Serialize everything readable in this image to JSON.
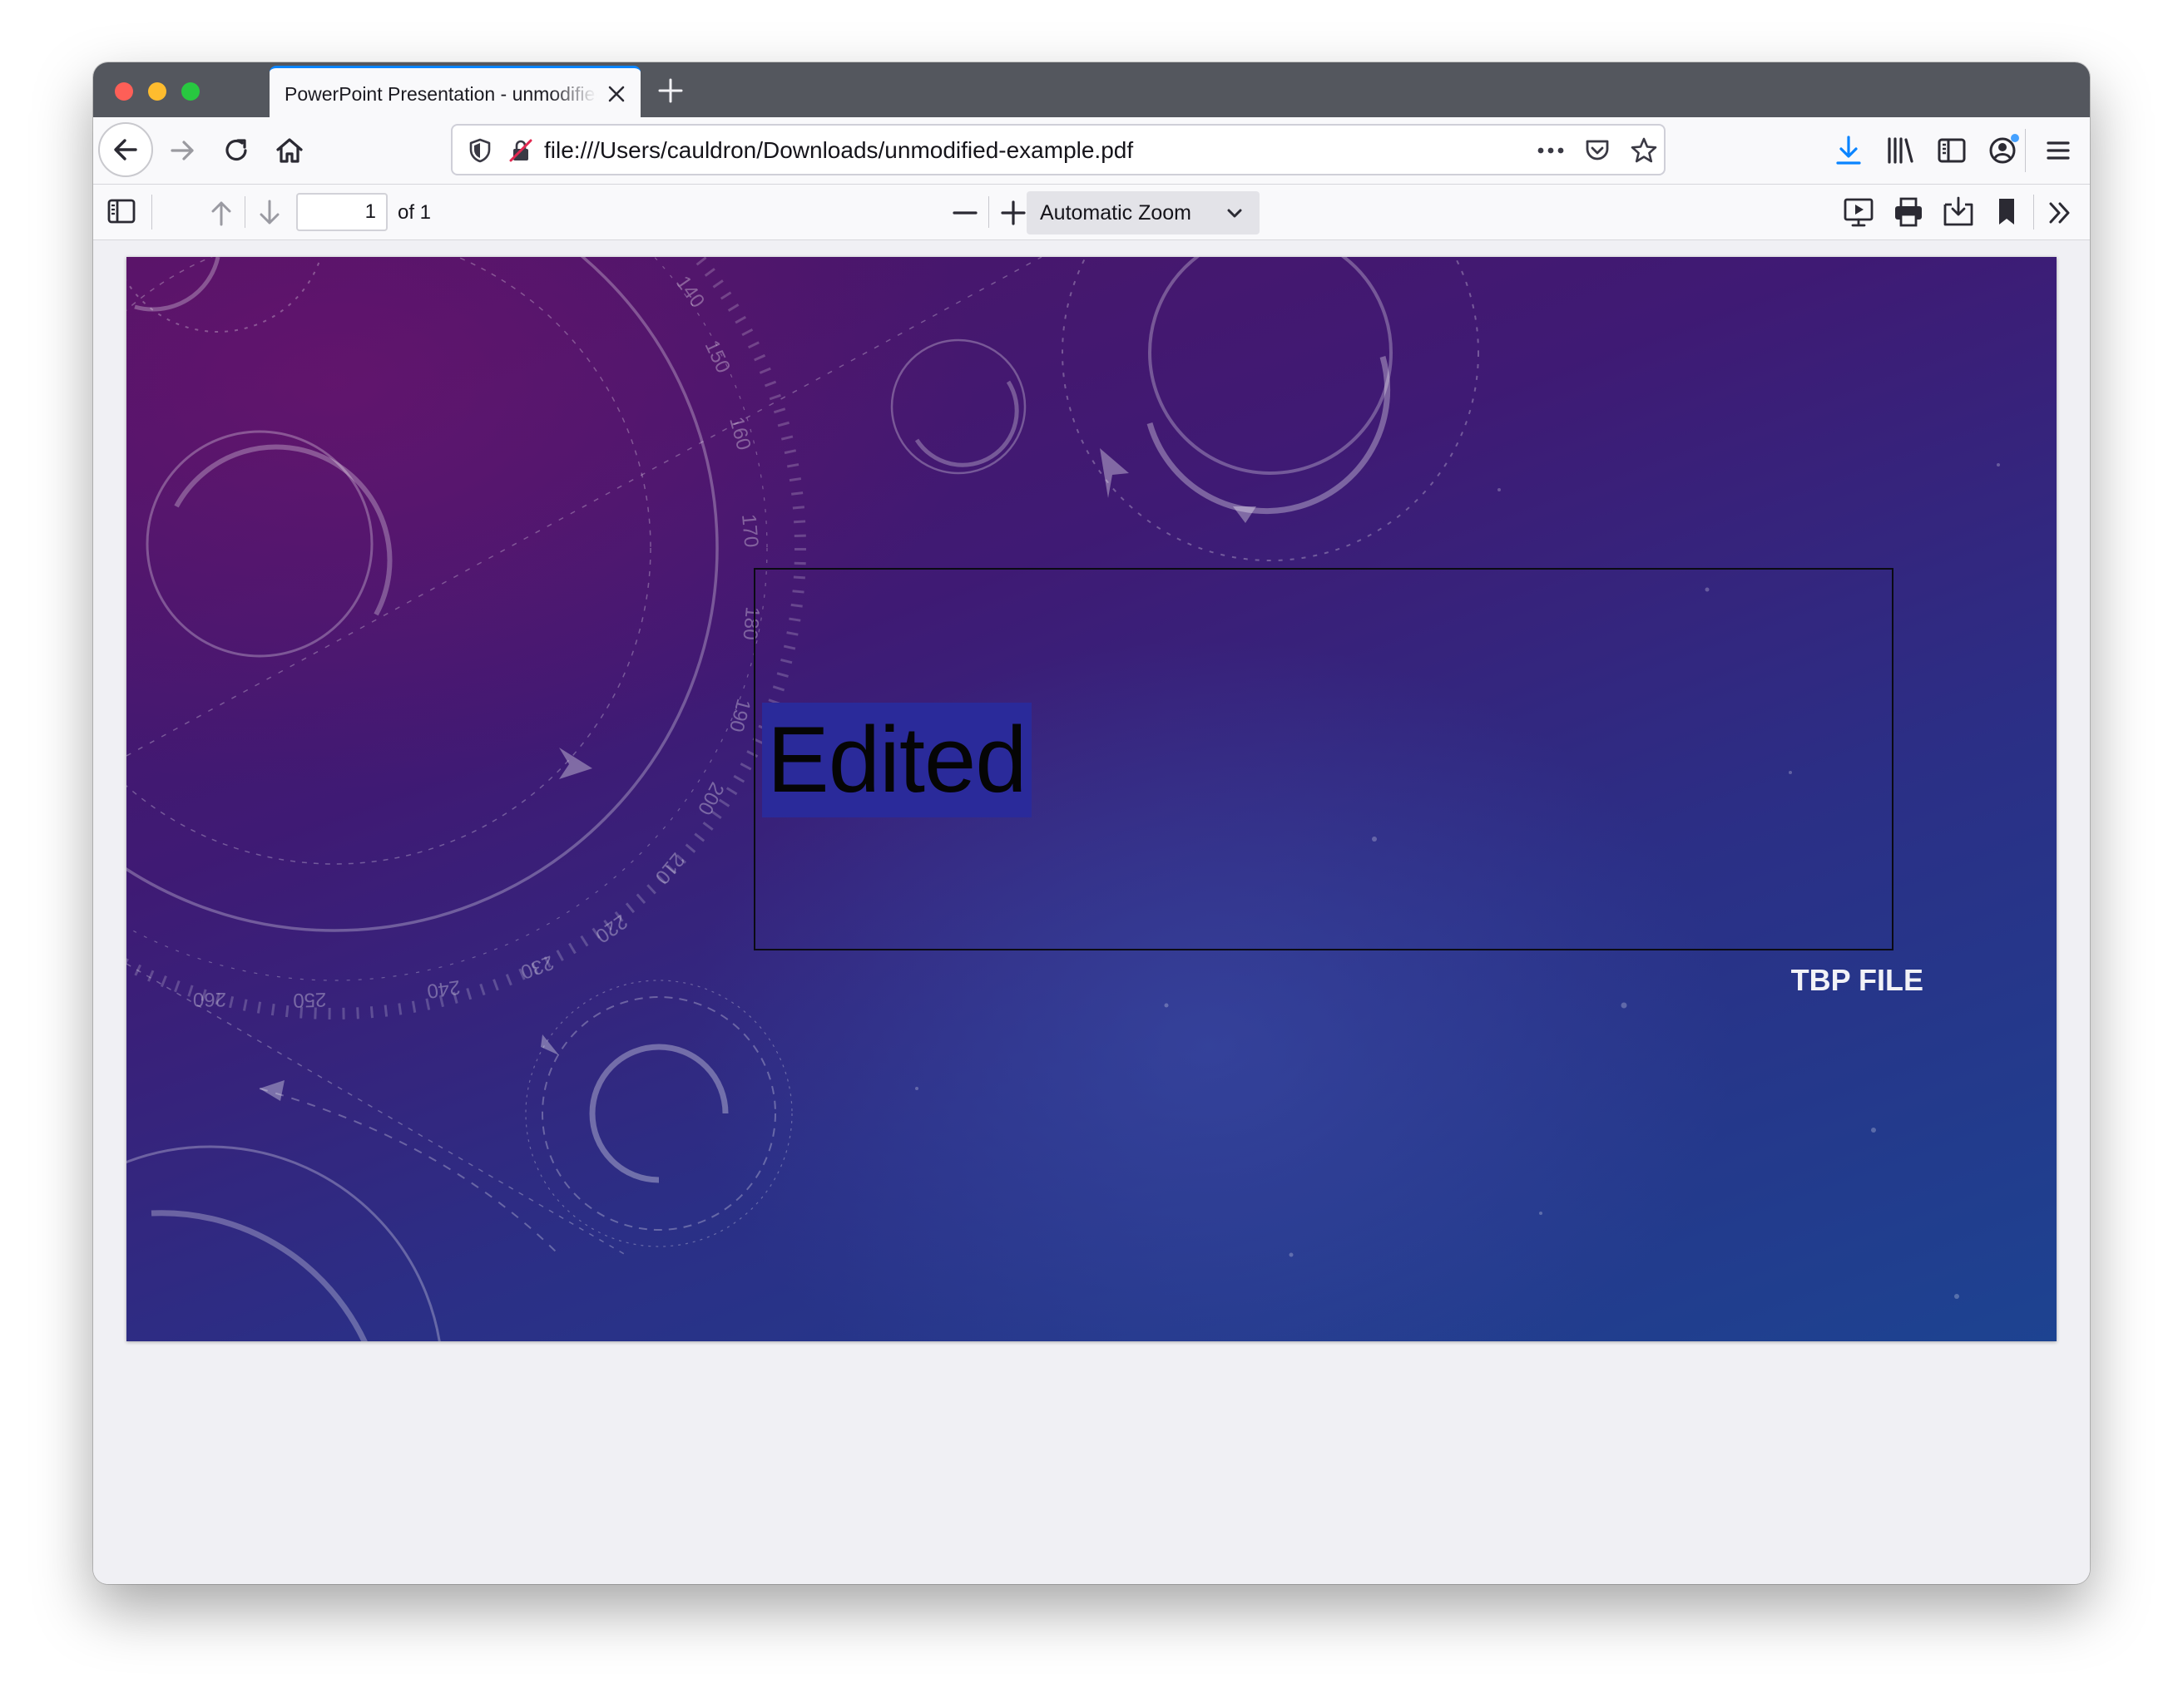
{
  "window": {
    "tab_title": "PowerPoint Presentation - unmodified-example.pdf"
  },
  "navbar": {
    "url": "file:///Users/cauldron/Downloads/unmodified-example.pdf"
  },
  "pdf_toolbar": {
    "page_number": "1",
    "page_count_label": "of 1",
    "zoom_label": "Automatic Zoom"
  },
  "slide": {
    "main_text": "Edited",
    "footer_text": "TBP FILE",
    "dial_numbers": [
      "140",
      "150",
      "160",
      "170",
      "180",
      "190",
      "200",
      "210",
      "220",
      "230",
      "240",
      "250",
      "260"
    ]
  },
  "colors": {
    "accent": "#0a84ff",
    "tabbar": "#54575e",
    "selection": "#2a2a9a"
  }
}
